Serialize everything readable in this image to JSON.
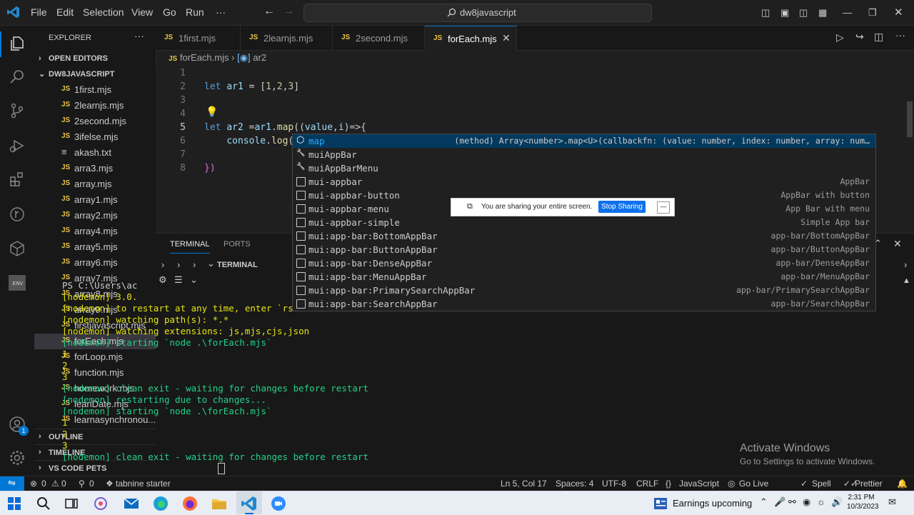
{
  "titlebar": {
    "menu": [
      "File",
      "Edit",
      "Selection",
      "View",
      "Go",
      "Run",
      "···"
    ],
    "search": "dw8javascript"
  },
  "sidebar": {
    "title": "EXPLORER",
    "open_editors": "OPEN EDITORS",
    "project": "DW8JAVASCRIPT",
    "files": [
      "1first.mjs",
      "2learnjs.mjs",
      "2second.mjs",
      "3ifelse.mjs",
      "akash.txt",
      "arra3.mjs",
      "array.mjs",
      "array1.mjs",
      "array2.mjs",
      "array4.mjs",
      "array5.mjs",
      "array6.mjs",
      "array7.mjs",
      "array8.mjs",
      "array9.mjs",
      "firstjavascript.mjs",
      "forEach.mjs",
      "forLoop.mjs",
      "function.mjs",
      "homework.mjs",
      "leanDate.mjs",
      "learnasynchronou..."
    ],
    "selected_file": "forEach.mjs",
    "outline": "OUTLINE",
    "timeline": "TIMELINE",
    "vscode_pets": "VS CODE PETS",
    "accounts_badge": "1"
  },
  "tabs": [
    {
      "label": "1first.mjs"
    },
    {
      "label": "2learnjs.mjs"
    },
    {
      "label": "2second.mjs"
    },
    {
      "label": "forEach.mjs",
      "active": true
    }
  ],
  "breadcrumb": {
    "file": "forEach.mjs",
    "symbol": "ar2"
  },
  "editor": {
    "line_numbers": [
      "1",
      "2",
      "3",
      "4",
      "5",
      "6",
      "7",
      "8"
    ],
    "line2": "let ar1 = [1,2,3]",
    "line5": "let ar2 =ar1.map((value,i)=>{",
    "line6": "    console.log(",
    "line8": "})"
  },
  "suggestions": [
    {
      "label": "map",
      "detail": "(method) Array<number>.map<U>(callbackfn: (value: number, index: number, array: num…",
      "icon": "method-icon"
    },
    {
      "label": "muiAppBar",
      "detail": "",
      "icon": "wrench-icon"
    },
    {
      "label": "muiAppBarMenu",
      "detail": "",
      "icon": "wrench-icon"
    },
    {
      "label": "mui-appbar",
      "detail": "AppBar",
      "icon": "snippet-icon"
    },
    {
      "label": "mui-appbar-button",
      "detail": "AppBar with button",
      "icon": "snippet-icon"
    },
    {
      "label": "mui-appbar-menu",
      "detail": "App Bar with menu",
      "icon": "snippet-icon"
    },
    {
      "label": "mui-appbar-simple",
      "detail": "Simple App bar",
      "icon": "snippet-icon"
    },
    {
      "label": "mui:app-bar:BottomAppBar",
      "detail": "app-bar/BottomAppBar",
      "icon": "snippet-icon"
    },
    {
      "label": "mui:app-bar:ButtonAppBar",
      "detail": "app-bar/ButtonAppBar",
      "icon": "snippet-icon"
    },
    {
      "label": "mui:app-bar:DenseAppBar",
      "detail": "app-bar/DenseAppBar",
      "icon": "snippet-icon"
    },
    {
      "label": "mui:app-bar:MenuAppBar",
      "detail": "app-bar/MenuAppBar",
      "icon": "snippet-icon"
    },
    {
      "label": "mui:app-bar:PrimarySearchAppBar",
      "detail": "app-bar/PrimarySearchAppBar",
      "icon": "snippet-icon"
    },
    {
      "label": "mui:app-bar:SearchAppBar",
      "detail": "app-bar/SearchAppBar",
      "icon": "snippet-icon"
    }
  ],
  "sharing": {
    "message": "You are sharing your entire screen.",
    "button": "Stop Sharing"
  },
  "panel": {
    "tab_terminal": "TERMINAL",
    "tab_ports": "PORTS",
    "terminal_title": "TERMINAL"
  },
  "terminal": [
    {
      "text": "PS C:\\Users\\ac",
      "color": "tw"
    },
    {
      "text": "[nodemon] 3.0.",
      "color": "ty"
    },
    {
      "text": "[nodemon] to restart at any time, enter `rs`",
      "color": "ty"
    },
    {
      "text": "[nodemon] watching path(s): *.*",
      "color": "ty"
    },
    {
      "text": "[nodemon] watching extensions: js,mjs,cjs,json",
      "color": "ty"
    },
    {
      "text": "[nodemon] starting `node .\\forEach.mjs`",
      "color": "tg"
    },
    {
      "text": "1",
      "color": "ty"
    },
    {
      "text": "2",
      "color": "ty"
    },
    {
      "text": "3",
      "color": "ty"
    },
    {
      "text": "[nodemon] clean exit - waiting for changes before restart",
      "color": "tg"
    },
    {
      "text": "[nodemon] restarting due to changes...",
      "color": "tg"
    },
    {
      "text": "[nodemon] starting `node .\\forEach.mjs`",
      "color": "tg"
    },
    {
      "text": "1",
      "color": "ty"
    },
    {
      "text": "2",
      "color": "ty"
    },
    {
      "text": "3",
      "color": "ty"
    },
    {
      "text": "[nodemon] clean exit - waiting for changes before restart",
      "color": "tg"
    }
  ],
  "watermark": {
    "title": "Activate Windows",
    "subtitle": "Go to Settings to activate Windows."
  },
  "statusbar": {
    "errors": "0",
    "warnings": "0",
    "info": "0",
    "tabnine": "tabnine starter",
    "position": "Ln 5, Col 17",
    "spaces": "Spaces: 4",
    "encoding": "UTF-8",
    "eol": "CRLF",
    "language": "JavaScript",
    "golive": "Go Live",
    "spell": "Spell",
    "prettier": "Prettier"
  },
  "taskbar": {
    "news": "Earnings upcoming",
    "time": "2:31 PM",
    "date": "10/3/2023"
  },
  "colors": {
    "accent": "#0078d4",
    "js_icon": "#e8c44a",
    "sel_suggest": "#04395e"
  }
}
